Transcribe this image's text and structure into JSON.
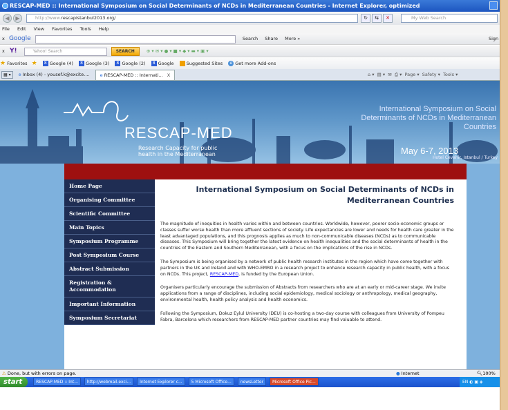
{
  "window": {
    "title": "RESCAP-MED :: International Symposium on Social Determinants of NCDs in Mediterranean Countries - Internet Explorer, optimized"
  },
  "address_bar": {
    "url_prefix": "http://www.",
    "url_host": "rescapistanbul2013.org/",
    "search_placeholder": "My Web Search"
  },
  "menu": [
    "File",
    "Edit",
    "View",
    "Favorites",
    "Tools",
    "Help"
  ],
  "google_toolbar": {
    "close": "x",
    "brand": "Google",
    "search": "Search",
    "share": "Share",
    "more": "More »",
    "sign_in": "Sign I"
  },
  "yahoo_toolbar": {
    "close": "x",
    "brand": "Y!",
    "placeholder": "Yahoo! Search",
    "search_button": "SEARCH"
  },
  "favorites_bar": {
    "label": "Favorites",
    "items": [
      "Google (4)",
      "Google (3)",
      "Google (2)",
      "Google",
      "Suggested Sites",
      "Get more Add-ons"
    ]
  },
  "command_bar": {
    "page": "Page",
    "safety": "Safety",
    "tools": "Tools"
  },
  "tabs": [
    {
      "label": "Inbox (4) - yousef.k@excite...."
    },
    {
      "label": "RESCAP-MED :: Internati...",
      "close": "X"
    }
  ],
  "banner": {
    "logo": "RESCAP-MED",
    "logo_sub": "Research Capacity for public health in the Mediterranean",
    "event_title": "International Symposium on Social Determinants of NCDs in Mediterranean Countries",
    "event_date": "May 6-7, 2013",
    "venue": "Hotel Cevahir, Istanbul / Turkey"
  },
  "sidebar": [
    {
      "label": "Home Page"
    },
    {
      "label": "Organising Committee"
    },
    {
      "label": "Scientific Committee"
    },
    {
      "label": "Main Topics"
    },
    {
      "label": "Symposium Programme"
    },
    {
      "label": "Post Symposium Course"
    },
    {
      "label": "Abstract Submission"
    },
    {
      "label": "Registration & Accommodation"
    },
    {
      "label": "Important Information"
    },
    {
      "label": "Symposium Secretariat"
    }
  ],
  "main": {
    "heading": "International Symposium on Social Determinants of NCDs in Mediterranean Countries",
    "p1": "The magnitude of inequities in health varies within and between countries. Worldwide, however, poorer socio-economic groups or classes suffer worse health than more affluent sections of society. Life expectancies are lower and needs for health care greater in the least advantaged populations, and this prognosis applies as much to non-communicable diseases (NCDs) as to communicable diseases. This Symposium will bring together the latest evidence on health inequalities and the social determinants of health in the countries of the Eastern and Southern Mediterranean, with a focus on the implications of the rise in NCDs.",
    "p2_before": "The Symposium is being organised by a network of public health research institutes in the region which have come together with partners in the UK and Ireland and with WHO-EMRO in a research project to enhance research capacity in public health, with a focus on NCDs. This project, ",
    "p2_link": "RESCAP-MED",
    "p2_after": ", is funded by the European Union.",
    "p3": "Organisers particularly encourage the submission of Abstracts from researchers who are at an early or mid-career stage. We invite applications from a range of disciplines, including social epidemiology, medical sociology or anthropology, medical geography, environmental health, health policy analysis and health economics.",
    "p4": "Following the Symposium, Dokuz Eylul University (DEU) is co-hosting a two-day course with colleagues from University of Pompeu Fabra, Barcelona which researchers from RESCAP-MED partner countries may find valuable to attend."
  },
  "status_bar": {
    "message": "Done, but with errors on page.",
    "zone": "Internet",
    "zoom": "100%"
  },
  "taskbar": {
    "start": "start",
    "items": [
      "RESCAP-MED :: Int...",
      "http://webmail.exci...",
      "Internet Explorer c...",
      "5 Microsoft Office...",
      "newsLetter",
      "Microsoft Office Pic..."
    ],
    "lang": "EN"
  }
}
